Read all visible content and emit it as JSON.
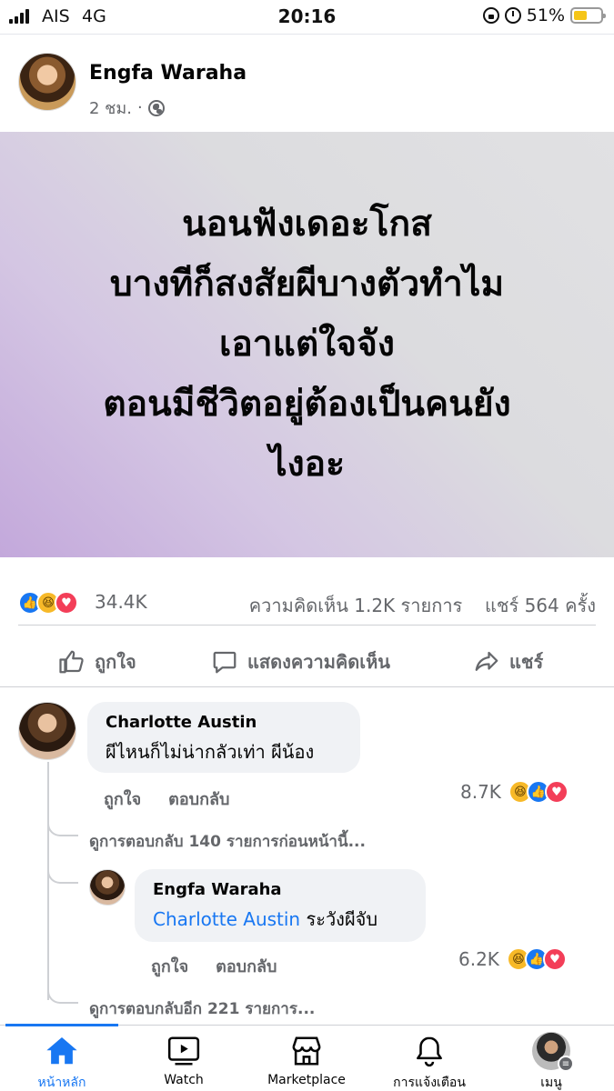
{
  "status_bar": {
    "carrier": "AIS",
    "network": "4G",
    "time": "20:16",
    "battery_text": "51%",
    "battery_level": 0.51
  },
  "post": {
    "author": "Engfa Waraha",
    "time": "2 ชม.",
    "separator": "·",
    "text_lines": [
      "นอนฟังเดอะโกส",
      "บางทีก็สงสัยผีบางตัวทำไม",
      "เอาแต่ใจจัง",
      "ตอนมีชีวิตอยู่ต้องเป็นคนยัง",
      "ไงอะ"
    ],
    "reaction_count": "34.4K",
    "comments_count": "ความคิดเห็น 1.2K รายการ",
    "shares_count": "แชร์ 564 ครั้ง"
  },
  "actions": {
    "like": "ถูกใจ",
    "comment": "แสดงความคิดเห็น",
    "share": "แชร์"
  },
  "comments": [
    {
      "author": "Charlotte Austin",
      "text": "ผีไหนก็ไม่น่ากลัวเท่า ผีน้อง",
      "like_label": "ถูกใจ",
      "reply_label": "ตอบกลับ",
      "reaction_count": "8.7K"
    }
  ],
  "view_previous_replies": "ดูการตอบกลับ 140 รายการก่อนหน้านี้...",
  "reply": {
    "author": "Engfa Waraha",
    "mention": "Charlotte Austin",
    "text": "ระวังผีจับ",
    "like_label": "ถูกใจ",
    "reply_label": "ตอบกลับ",
    "reaction_count": "6.2K"
  },
  "view_more_replies": "ดูการตอบกลับอีก 221 รายการ...",
  "tabbar": {
    "home": "หน้าหลัก",
    "watch": "Watch",
    "marketplace": "Marketplace",
    "notifications": "การแจ้งเตือน",
    "menu": "เมนู"
  },
  "colors": {
    "accent": "#1877f2",
    "secondary_text": "#65676b",
    "bubble": "#f0f2f5"
  }
}
